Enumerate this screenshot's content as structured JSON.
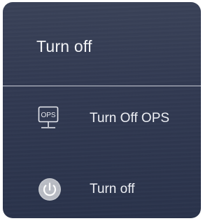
{
  "dialog": {
    "title": "Turn off",
    "items": [
      {
        "label": "Turn Off OPS",
        "icon": "ops-display-icon",
        "icon_text": "OPS"
      },
      {
        "label": "Turn off",
        "icon": "power-icon"
      }
    ]
  },
  "colors": {
    "background_top": "#3a4258",
    "background_bottom": "#2a334b",
    "divider": "#c9ccd6",
    "text": "#ffffff"
  }
}
